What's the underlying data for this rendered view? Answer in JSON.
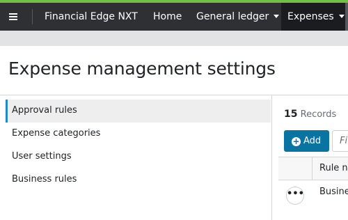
{
  "navbar": {
    "brand": "Financial Edge NXT",
    "items": [
      {
        "label": "Home",
        "dropdown": false
      },
      {
        "label": "General ledger",
        "dropdown": true
      },
      {
        "label": "Expenses",
        "dropdown": true,
        "active": true
      }
    ]
  },
  "page": {
    "title": "Expense management settings"
  },
  "sidebar": {
    "items": [
      {
        "label": "Approval rules",
        "active": true
      },
      {
        "label": "Expense categories",
        "active": false
      },
      {
        "label": "User settings",
        "active": false
      },
      {
        "label": "Business rules",
        "active": false
      }
    ]
  },
  "records": {
    "count": "15",
    "label": "Records"
  },
  "toolbar": {
    "add_label": "Add",
    "add_icon": "plus-circle-icon",
    "find_placeholder": "Fi"
  },
  "grid": {
    "column_header": "Rule na",
    "rows": [
      {
        "context_menu": "•••",
        "name": "Busine"
      }
    ]
  },
  "colors": {
    "accent_stripe": "#71bf43",
    "navbar_bg": "#2e3034",
    "primary_button": "#0974a1",
    "active_indicator": "#1f8ac9"
  }
}
